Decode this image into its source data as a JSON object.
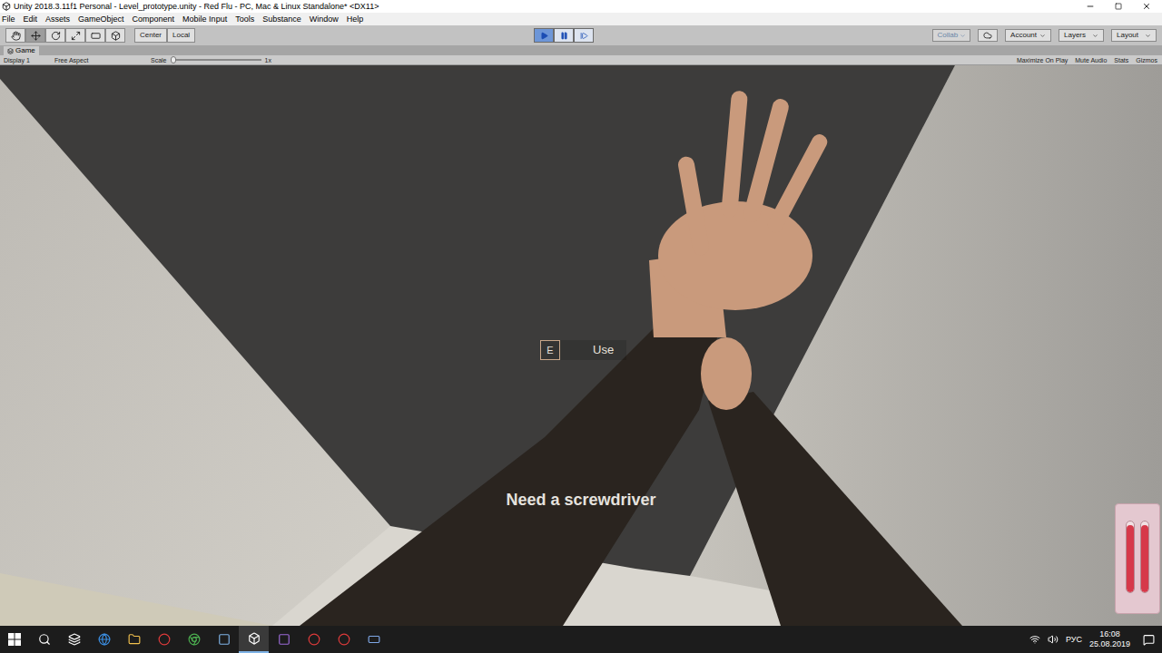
{
  "window": {
    "title": "Unity 2018.3.11f1 Personal - Level_prototype.unity - Red Flu - PC, Mac & Linux Standalone* <DX11>"
  },
  "menu": [
    "File",
    "Edit",
    "Assets",
    "GameObject",
    "Component",
    "Mobile Input",
    "Tools",
    "Substance",
    "Window",
    "Help"
  ],
  "toolbar": {
    "pivot": "Center",
    "space": "Local",
    "playing": true,
    "paused": false,
    "collab": "Collab",
    "account": "Account",
    "layers": "Layers",
    "layout": "Layout"
  },
  "game_tab": {
    "label": "Game"
  },
  "game_bar": {
    "display": "Display 1",
    "aspect": "Free Aspect",
    "scale_label": "Scale",
    "scale_value": "1x",
    "scale_level": 0.0,
    "toggles": [
      {
        "label": "Maximize On Play",
        "selected": false
      },
      {
        "label": "Mute Audio",
        "selected": false
      },
      {
        "label": "Stats",
        "selected": false
      },
      {
        "label": "Gizmos",
        "selected": false
      }
    ]
  },
  "hud": {
    "key": "E",
    "action": "Use",
    "message": "Need a screwdriver",
    "health_bars": [
      {
        "level": 0.95
      },
      {
        "level": 0.95
      }
    ]
  },
  "taskbar": {
    "language": "РУС",
    "time": "16:08",
    "date": "25.08.2019"
  }
}
